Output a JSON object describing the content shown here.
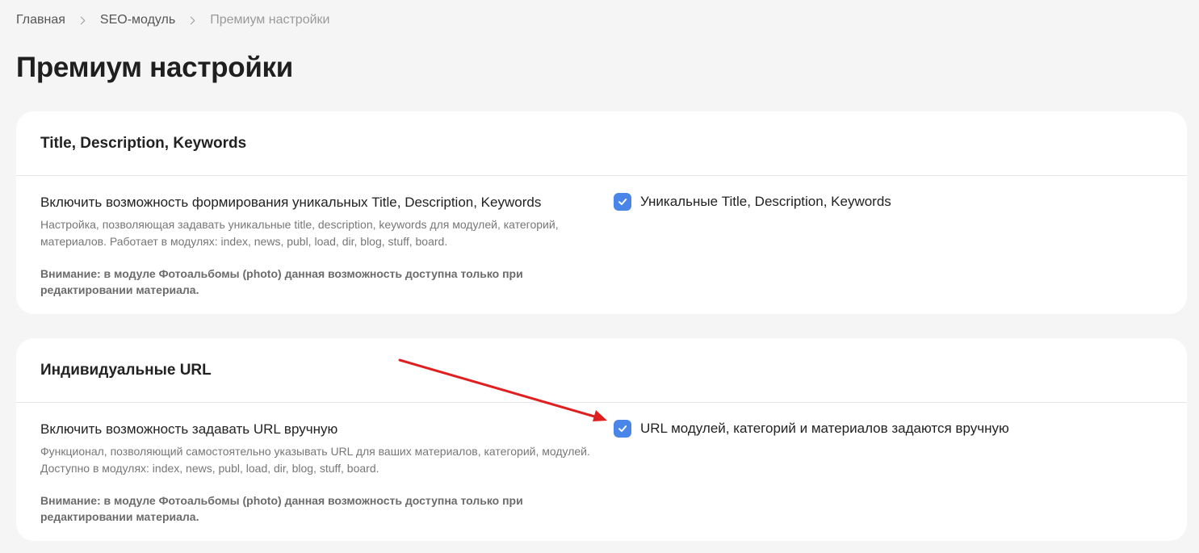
{
  "breadcrumb": {
    "items": [
      "Главная",
      "SEO-модуль"
    ],
    "current": "Премиум настройки"
  },
  "page_title": "Премиум настройки",
  "cards": [
    {
      "title": "Title, Description, Keywords",
      "setting": {
        "label": "Включить возможность формирования уникальных Title, Description, Keywords",
        "description": "Настройка, позволяющая задавать уникальные title, description, keywords для модулей, категорий, материалов. Работает в модулях: index, news, publ, load, dir, blog, stuff, board.",
        "warning": "Внимание: в модуле Фотоальбомы (photo) данная возможность доступна только при редактировании материала.",
        "checkbox_label": "Уникальные Title, Description, Keywords",
        "checked": true
      }
    },
    {
      "title": "Индивидуальные URL",
      "setting": {
        "label": "Включить возможность задавать URL вручную",
        "description": "Функционал, позволяющий самостоятельно указывать URL для ваших материалов, категорий, модулей. Доступно в модулях: index, news, publ, load, dir, blog, stuff, board.",
        "warning": "Внимание: в модуле Фотоальбомы (photo) данная возможность доступна только при редактировании материала.",
        "checkbox_label": "URL модулей, категорий и материалов задаются вручную",
        "checked": true
      }
    }
  ],
  "colors": {
    "background": "#f5f5f5",
    "card": "#ffffff",
    "checkbox": "#4a86e8",
    "annotation_arrow": "#e02020"
  },
  "icons": {
    "breadcrumb_separator": "chevron-right-icon",
    "checkbox_mark": "checkmark-icon",
    "annotation": "red-arrow-icon"
  }
}
